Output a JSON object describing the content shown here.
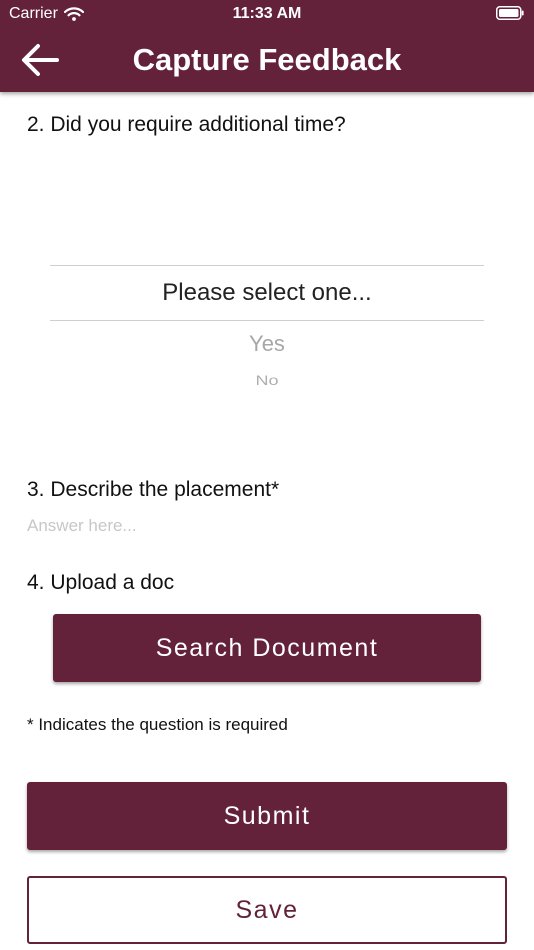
{
  "colors": {
    "primary": "#63223a",
    "on_primary": "#ffffff",
    "placeholder": "#c7c7c7",
    "picker_option": "#a7a7a7"
  },
  "status_bar": {
    "carrier": "Carrier",
    "time": "11:33 AM",
    "icons": [
      "wifi-icon",
      "battery-icon"
    ]
  },
  "header": {
    "title": "Capture Feedback",
    "back_icon": "arrow-left-icon"
  },
  "questions": {
    "q2": {
      "label": "2. Did you require additional time?",
      "picker": {
        "selected": "Please select one...",
        "options": [
          "Yes",
          "No"
        ]
      }
    },
    "q3": {
      "label": "3. Describe the placement*",
      "placeholder": "Answer here...",
      "value": ""
    },
    "q4": {
      "label": "4. Upload a doc",
      "button": "Search Document"
    }
  },
  "required_note": "* Indicates the question is required",
  "actions": {
    "submit": "Submit",
    "save": "Save"
  }
}
